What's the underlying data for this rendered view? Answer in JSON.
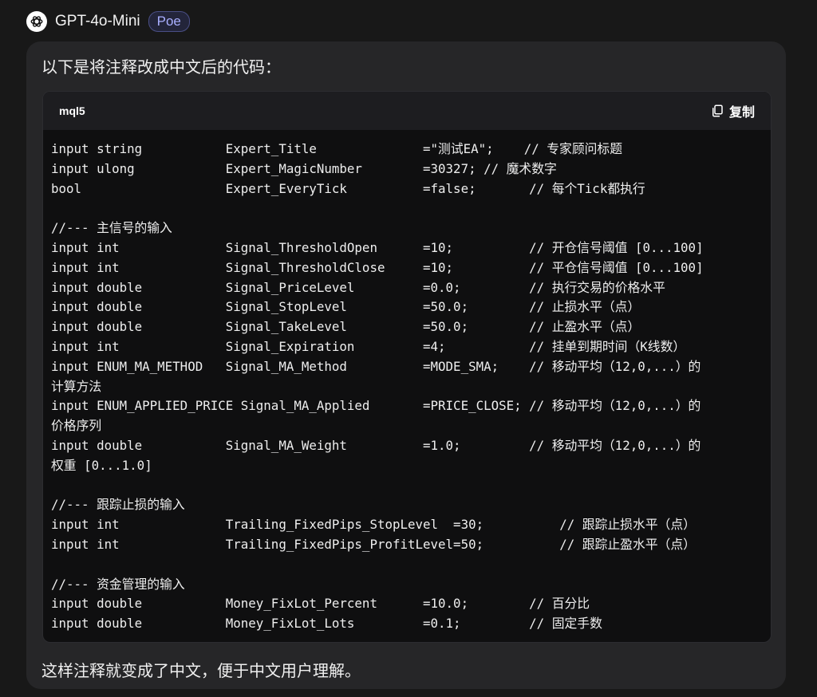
{
  "header": {
    "bot_name": "GPT-4o-Mini",
    "platform_badge": "Poe"
  },
  "message": {
    "intro": "以下是将注释改成中文后的代码：",
    "code_block": {
      "language": "mql5",
      "copy_label": "复制",
      "lines": [
        "input string           Expert_Title              =\"测试EA\";    // 专家顾问标题",
        "input ulong            Expert_MagicNumber        =30327; // 魔术数字",
        "bool                   Expert_EveryTick          =false;       // 每个Tick都执行",
        "",
        "//--- 主信号的输入",
        "input int              Signal_ThresholdOpen      =10;          // 开仓信号阈值 [0...100]",
        "input int              Signal_ThresholdClose     =10;          // 平仓信号阈值 [0...100]",
        "input double           Signal_PriceLevel         =0.0;         // 执行交易的价格水平",
        "input double           Signal_StopLevel          =50.0;        // 止损水平（点）",
        "input double           Signal_TakeLevel          =50.0;        // 止盈水平（点）",
        "input int              Signal_Expiration         =4;           // 挂单到期时间（K线数）",
        "input ENUM_MA_METHOD   Signal_MA_Method          =MODE_SMA;    // 移动平均（12,0,...）的",
        "计算方法",
        "input ENUM_APPLIED_PRICE Signal_MA_Applied       =PRICE_CLOSE; // 移动平均（12,0,...）的",
        "价格序列",
        "input double           Signal_MA_Weight          =1.0;         // 移动平均（12,0,...）的",
        "权重 [0...1.0]",
        "",
        "//--- 跟踪止损的输入",
        "input int              Trailing_FixedPips_StopLevel  =30;          // 跟踪止损水平（点）",
        "input int              Trailing_FixedPips_ProfitLevel=50;          // 跟踪止盈水平（点）",
        "",
        "//--- 资金管理的输入",
        "input double           Money_FixLot_Percent      =10.0;        // 百分比",
        "input double           Money_FixLot_Lots         =0.1;         // 固定手数"
      ]
    },
    "outro": "这样注释就变成了中文，便于中文用户理解。"
  }
}
